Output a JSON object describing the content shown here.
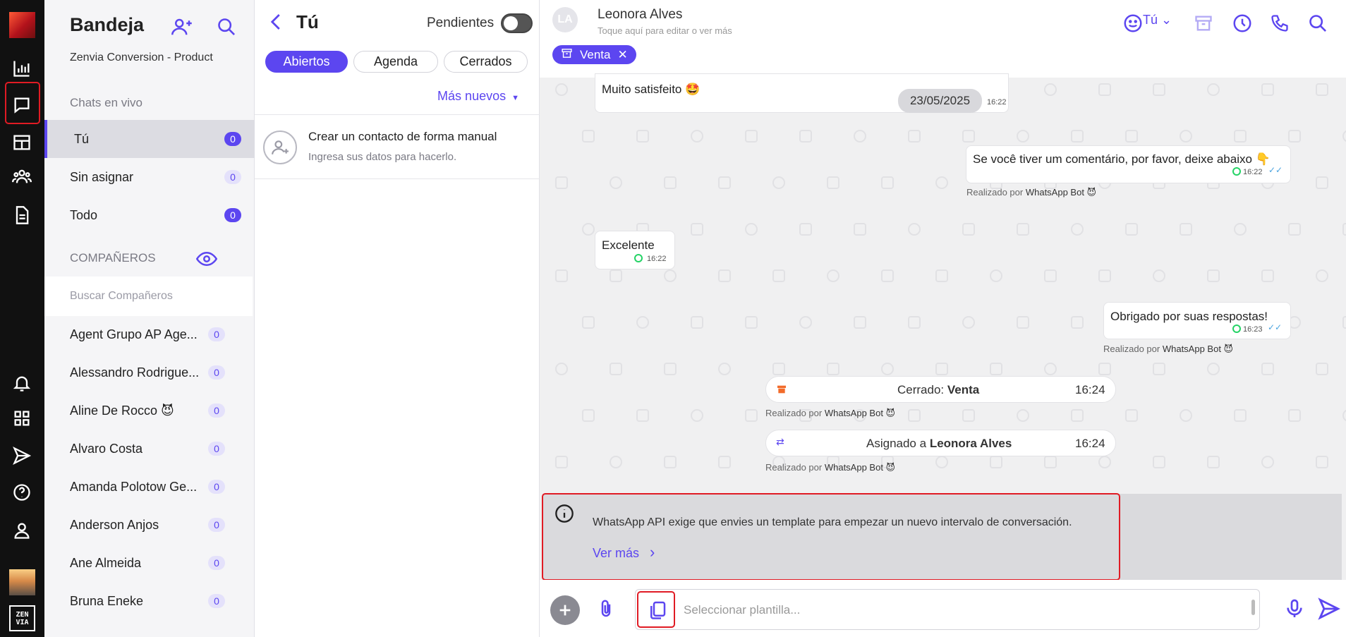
{
  "inbox": {
    "title": "Bandeja",
    "org": "Zenvia Conversion - Product",
    "section_live": "Chats en vivo",
    "nav": [
      {
        "label": "Tú",
        "count": "0"
      },
      {
        "label": "Sin asignar",
        "count": "0"
      },
      {
        "label": "Todo",
        "count": "0"
      }
    ],
    "section_mates": "COMPAÑEROS",
    "search_placeholder": "Buscar Compañeros",
    "mates": [
      {
        "name": "Agent Grupo AP Age...",
        "count": "0"
      },
      {
        "name": "Alessandro Rodrigue...",
        "count": "0"
      },
      {
        "name": "Aline De Rocco 😈",
        "count": "0"
      },
      {
        "name": "Alvaro Costa",
        "count": "0"
      },
      {
        "name": "Amanda Polotow Ge...",
        "count": "0"
      },
      {
        "name": "Anderson Anjos",
        "count": "0"
      },
      {
        "name": "Ane Almeida",
        "count": "0"
      },
      {
        "name": "Bruna Eneke",
        "count": "0"
      }
    ]
  },
  "list": {
    "title": "Tú",
    "pending_label": "Pendientes",
    "tabs": [
      "Abiertos",
      "Agenda",
      "Cerrados"
    ],
    "sort_label": "Más nuevos",
    "contact_title": "Crear un contacto de forma manual",
    "contact_sub": "Ingresa sus datos para hacerlo."
  },
  "chat": {
    "initials": "LA",
    "name": "Leonora Alves",
    "subtitle": "Toque aquí para editar o ver más",
    "agent_label": "Tú",
    "tag": "Venta",
    "messages": {
      "m1_text": "Muito satisfeito 🤩",
      "date": "23/05/2025",
      "m1_time": "16:22",
      "m2_text": "Se você tiver um comentário, por favor, deixe abaixo 👇",
      "m2_time": "16:22",
      "m2_by_prefix": "Realizado por",
      "m2_by": "WhatsApp Bot 😈",
      "m3_text": "Excelente",
      "m3_time": "16:22",
      "m4_text": "Obrigado por suas respostas!",
      "m4_time": "16:23",
      "m4_by_prefix": "Realizado por",
      "m4_by": "WhatsApp Bot 😈",
      "s1_prefix": "Cerrado:",
      "s1_value": "Venta",
      "s1_time": "16:24",
      "s1_by_prefix": "Realizado por",
      "s1_by": "WhatsApp Bot 😈",
      "s2_prefix": "Asignado a",
      "s2_value": "Leonora Alves",
      "s2_time": "16:24",
      "s2_by_prefix": "Realizado por",
      "s2_by": "WhatsApp Bot 😈"
    },
    "notice": "WhatsApp API exige que envies un template para empezar un nuevo intervalo de conversación.",
    "notice_link": "Ver más",
    "input_placeholder": "Seleccionar plantilla..."
  },
  "colors": {
    "accent": "#5c46f0",
    "rail": "#111111",
    "highlight": "#e01b24",
    "whatsapp": "#25d366"
  }
}
